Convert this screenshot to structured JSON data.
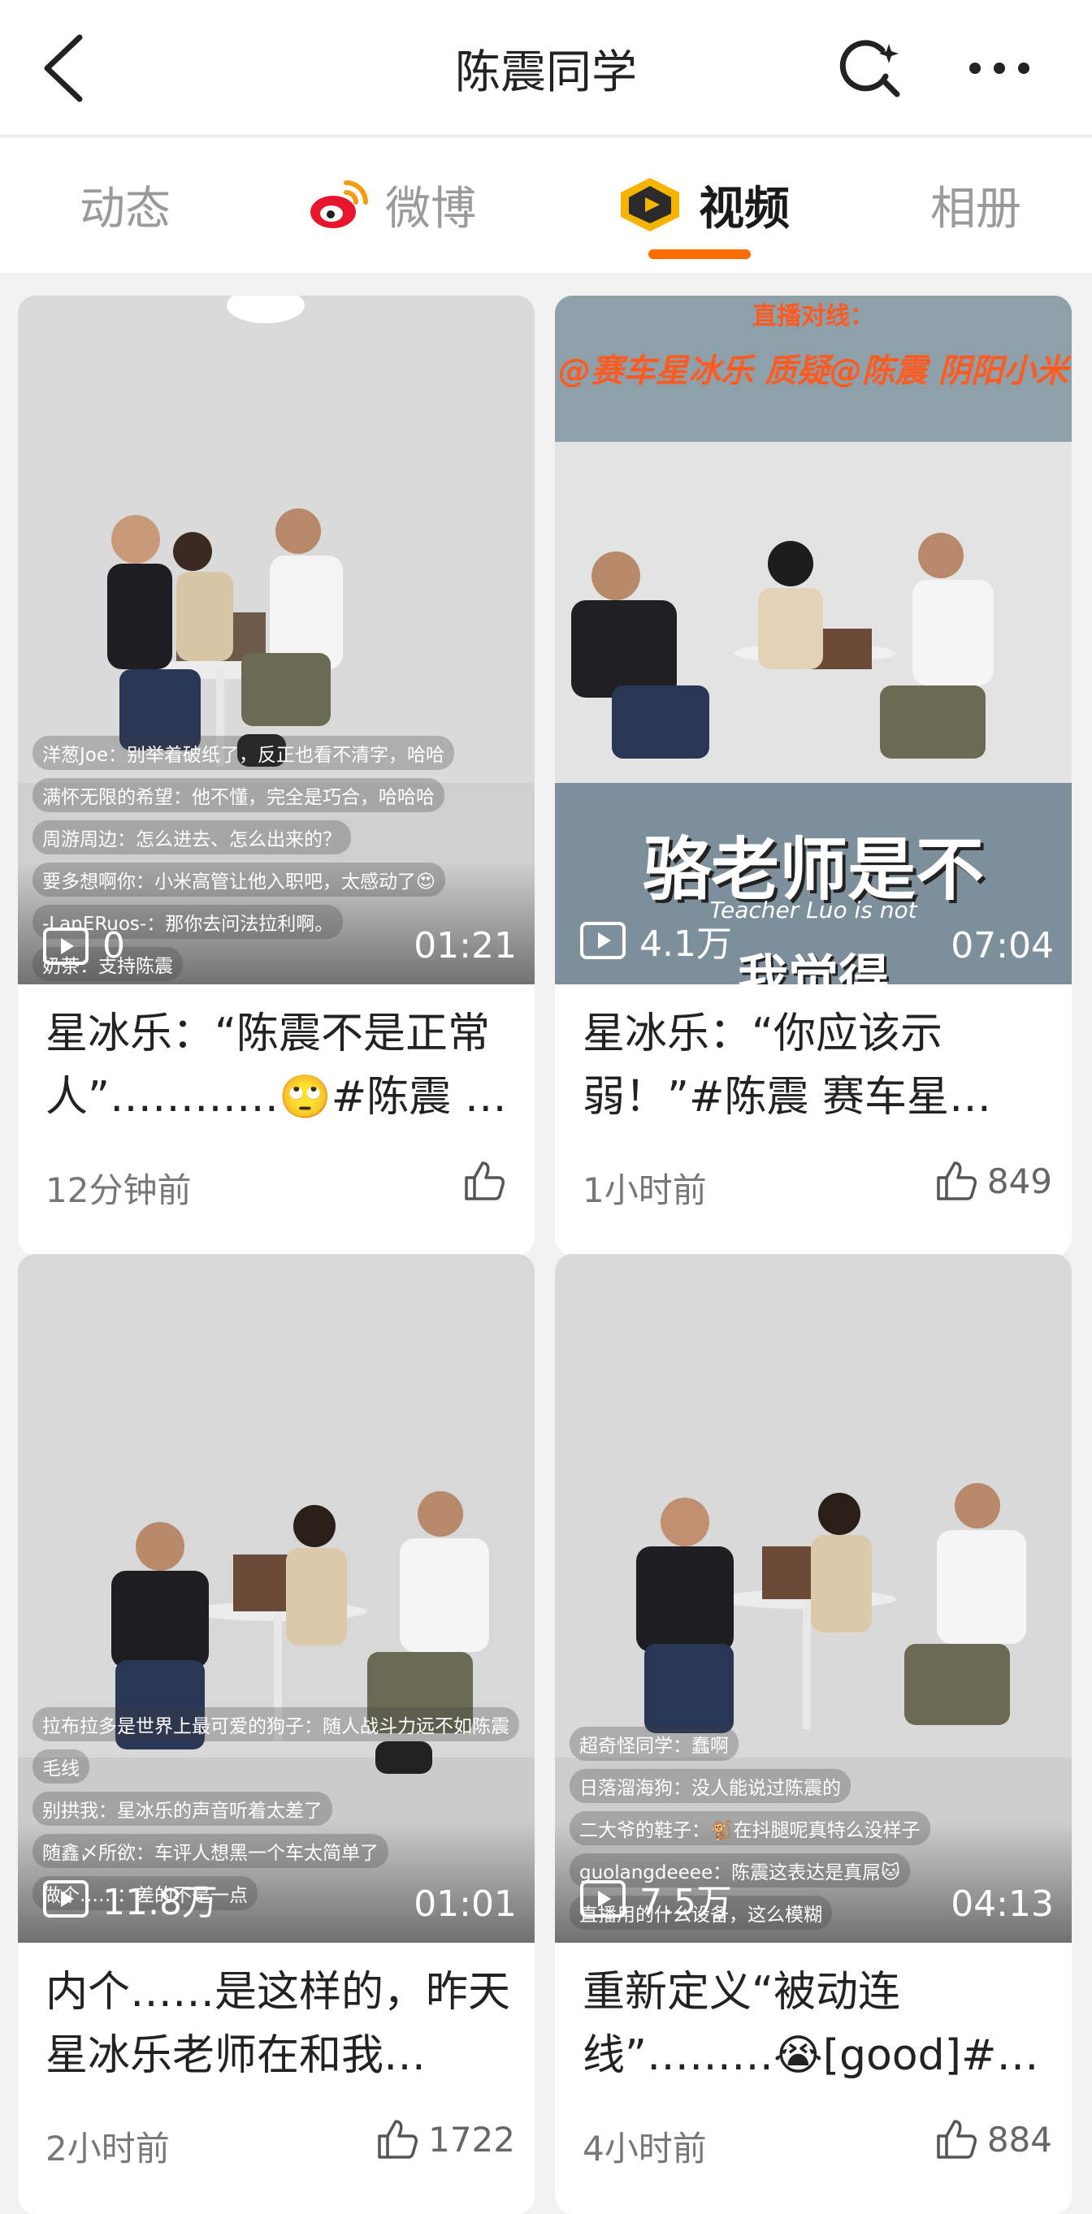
{
  "header": {
    "title": "陈震同学"
  },
  "tabs": [
    {
      "label": "动态"
    },
    {
      "label": "微博"
    },
    {
      "label": "视频"
    },
    {
      "label": "相册"
    }
  ],
  "videos": [
    {
      "title": "星冰乐：“陈震不是正常人”…………🙄#陈震 …",
      "time": "12分钟前",
      "likes": "",
      "plays": "0",
      "duration": "01:21",
      "danmaku": [
        "洋葱Joe：别举着破纸了，反正也看不清字，哈哈",
        "满怀无限的希望：他不懂，完全是巧合，哈哈哈",
        "周游周边：怎么进去、怎么出来的？",
        "要多想啊你：小米高管让他入职吧，太感动了😍",
        "-LanERuos-：那你去问法拉利啊。",
        "奶茶：支持陈震"
      ]
    },
    {
      "title": "星冰乐：“你应该示弱！”#陈震 赛车星…",
      "time": "1小时前",
      "likes": "849",
      "plays": "4.1万",
      "duration": "07:04",
      "overlay_top": "@赛车星冰乐 质疑@陈震 阴阳小米",
      "overlay_top_small": "直播对线：",
      "overlay_big": "骆老师是不",
      "overlay_sub": "Teacher Luo is not",
      "overlay_bottom": "我觉得"
    },
    {
      "title": "内个……是这样的，昨天星冰乐老师在和我…",
      "time": "2小时前",
      "likes": "1722",
      "plays": "11.8万",
      "duration": "01:01",
      "danmaku": [
        "拉布拉多是世界上最可爱的狗子：随人战斗力远不如陈震",
        "毛线",
        "别拱我：星冰乐的声音听着太差了",
        "随鑫〆所欲：车评人想黑一个车太简单了",
        "做个……：差的不是一点"
      ]
    },
    {
      "title": "重新定义“被动连线”………😭[good]#…",
      "time": "4小时前",
      "likes": "884",
      "plays": "7.5万",
      "duration": "04:13",
      "danmaku": [
        "超奇怪同学：蠢啊",
        "日落溜海狗：没人能说过陈震的",
        "二大爷的鞋子：🐒在抖腿呢真特么没样子",
        "guolangdeeee：陈震这表达是真屌🐱",
        "直播用的什么设备，这么模糊"
      ]
    }
  ]
}
